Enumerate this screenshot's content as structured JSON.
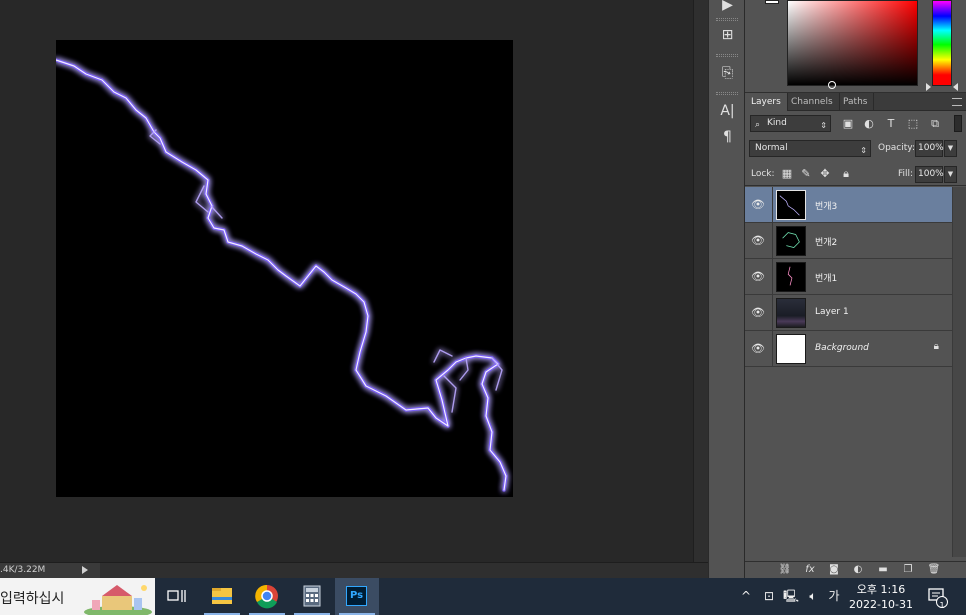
{
  "status": {
    "doc_size": ".4K/3.22M"
  },
  "tabs": [
    {
      "label": "Layers",
      "active": true
    },
    {
      "label": "Channels",
      "active": false
    },
    {
      "label": "Paths",
      "active": false
    }
  ],
  "filter": {
    "kind_label": "Kind"
  },
  "blend": {
    "mode": "Normal",
    "opacity_label": "Opacity:",
    "opacity_value": "100%"
  },
  "lock": {
    "label": "Lock:",
    "fill_label": "Fill:",
    "fill_value": "100%"
  },
  "layers": [
    {
      "name": "번개3",
      "selected": true
    },
    {
      "name": "번개2",
      "selected": false
    },
    {
      "name": "번개1",
      "selected": false
    },
    {
      "name": "Layer 1",
      "selected": false
    },
    {
      "name": "Background",
      "selected": false,
      "locked": true
    }
  ],
  "taskbar": {
    "search_text": "입력하십시",
    "photoshop_label": "Ps",
    "ime_label": "가",
    "clock_time": "오후 1:16",
    "clock_date": "2022-10-31",
    "notification_count": "1"
  },
  "colors": {
    "canvas_bg": "#000000",
    "lightning": "#a58cff",
    "selected_layer": "#6a7f9e",
    "taskbar": "#1f2b3a"
  }
}
